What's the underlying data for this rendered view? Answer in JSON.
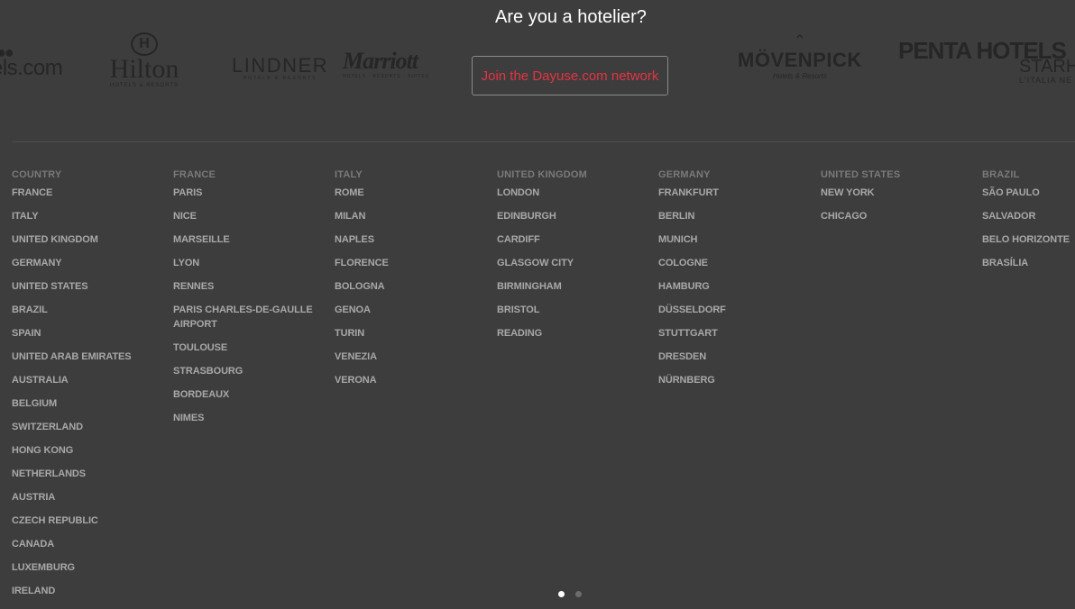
{
  "hotelier": {
    "title": "Are you a hotelier?",
    "cta_label": "Join the Dayuse.com network"
  },
  "logos": {
    "hotelscom": "els.com",
    "hilton": "Hilton",
    "hilton_sub": "HOTELS & RESORTS",
    "lindner": "LINDNER",
    "lindner_sub": "HOTELS & RESORTS",
    "marriott": "Marriott",
    "marriott_sub": "HOTELS · RESORTS · SUITES",
    "movenpick": "MÖVENPICK",
    "movenpick_sub": "Hotels & Resorts",
    "penta": "PENTA HOTELS",
    "starhotels": "STARHO",
    "starhotels_sub": "L'ITALIA NE"
  },
  "columns": [
    {
      "heading": "COUNTRY",
      "items": [
        "FRANCE",
        "ITALY",
        "UNITED KINGDOM",
        "GERMANY",
        "UNITED STATES",
        "BRAZIL",
        "SPAIN",
        "UNITED ARAB EMIRATES",
        "AUSTRALIA",
        "BELGIUM",
        "SWITZERLAND",
        "HONG KONG",
        "NETHERLANDS",
        "AUSTRIA",
        "CZECH REPUBLIC",
        "CANADA",
        "LUXEMBURG",
        "IRELAND"
      ]
    },
    {
      "heading": "FRANCE",
      "items": [
        "PARIS",
        "NICE",
        "MARSEILLE",
        "LYON",
        "RENNES",
        "PARIS CHARLES-DE-GAULLE AIRPORT",
        "TOULOUSE",
        "STRASBOURG",
        "BORDEAUX",
        "NIMES"
      ]
    },
    {
      "heading": "ITALY",
      "items": [
        "ROME",
        "MILAN",
        "NAPLES",
        "FLORENCE",
        "BOLOGNA",
        "GENOA",
        "TURIN",
        "VENEZIA",
        "VERONA"
      ]
    },
    {
      "heading": "UNITED KINGDOM",
      "items": [
        "LONDON",
        "EDINBURGH",
        "CARDIFF",
        "GLASGOW CITY",
        "BIRMINGHAM",
        "BRISTOL",
        "READING"
      ]
    },
    {
      "heading": "GERMANY",
      "items": [
        "FRANKFURT",
        "BERLIN",
        "MUNICH",
        "COLOGNE",
        "HAMBURG",
        "DÜSSELDORF",
        "STUTTGART",
        "DRESDEN",
        "NÜRNBERG"
      ]
    },
    {
      "heading": "UNITED STATES",
      "items": [
        "NEW YORK",
        "CHICAGO"
      ]
    },
    {
      "heading": "BRAZIL",
      "items": [
        "SÃO PAULO",
        "SALVADOR",
        "BELO HORIZONTE",
        "BRASÍLIA"
      ]
    }
  ],
  "carousel": {
    "page_count": 2,
    "active_page": 1
  }
}
